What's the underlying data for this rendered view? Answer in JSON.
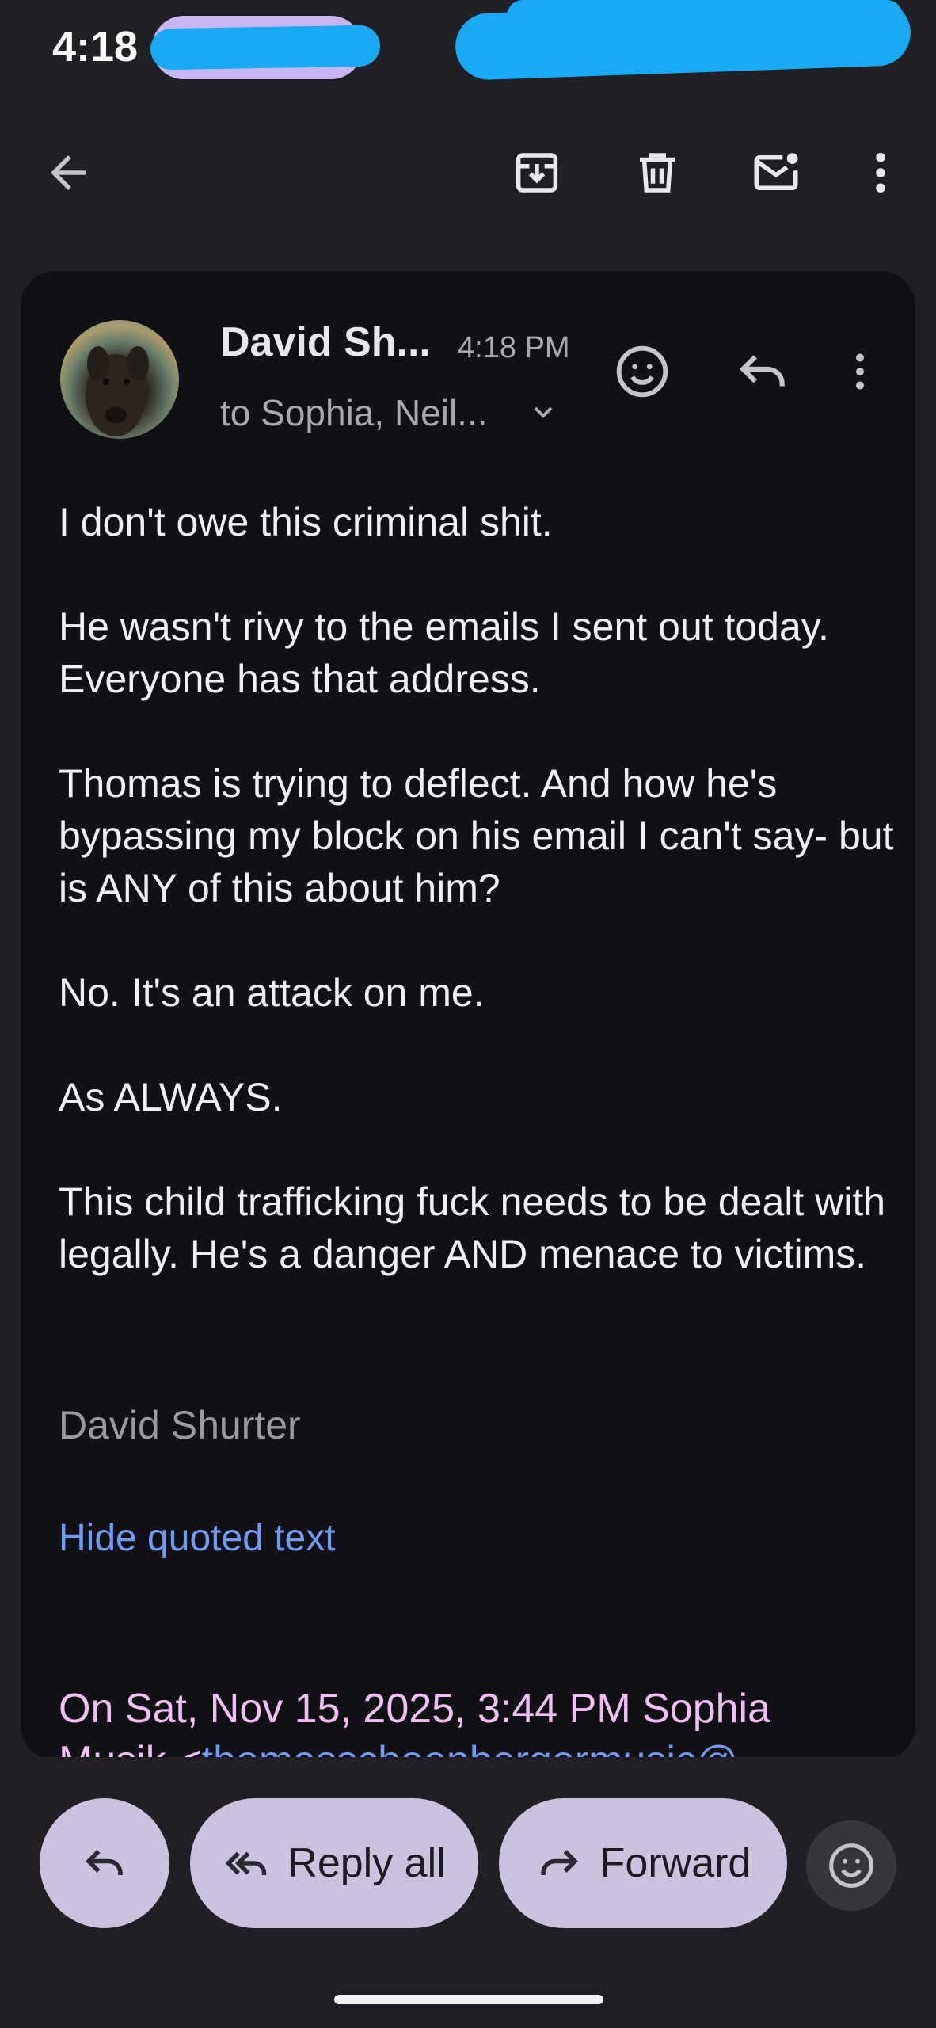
{
  "status_bar": {
    "time": "4:18"
  },
  "toolbar": {
    "icons": [
      "back-arrow-icon",
      "archive-icon",
      "delete-icon",
      "mark-unread-icon",
      "more-vert-icon"
    ]
  },
  "message": {
    "sender": "David Sh...",
    "time": "4:18 PM",
    "recipients": "to Sophia, Neil...",
    "body": [
      "I don't owe this criminal shit.",
      "He wasn't rivy to the emails I sent out today. Everyone has that address.",
      "Thomas is trying to deflect. And how he's bypassing my block on his email I can't say- but is ANY of this about him?",
      "No. It's an attack on me.",
      "As ALWAYS.",
      "This child trafficking fuck needs to be dealt with legally. He's a danger AND menace to victims."
    ],
    "signature": "David Shurter",
    "hide_quoted": "Hide quoted text",
    "quote_header": "On Sat, Nov 15, 2025, 3:44 PM Sophia",
    "quote_header_line2_prefix": "Musik <",
    "quote_header_email": "thomasschoenbergermusic@"
  },
  "actions": {
    "reply_all": "Reply all",
    "forward": "Forward"
  },
  "colors": {
    "background": "#1f1f24",
    "card": "#111115",
    "pill": "#cbc3dd",
    "link": "#6f9bf2",
    "quote": "#f0bff3"
  }
}
